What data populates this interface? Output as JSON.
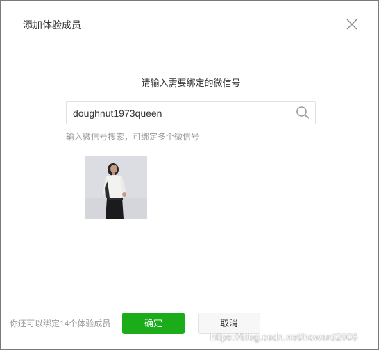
{
  "dialog": {
    "title": "添加体验成员",
    "close_icon": "close-icon"
  },
  "prompt": "请输入需要绑定的微信号",
  "search": {
    "value": "doughnut1973queen",
    "icon": "search-icon"
  },
  "hint": "输入微信号搜索，可绑定多个微信号",
  "result": {
    "avatar_icon": "user-avatar-photo"
  },
  "footer": {
    "note": "你还可以绑定14个体验成员",
    "confirm_label": "确定",
    "cancel_label": "取消"
  },
  "watermark": "https://blog.csdn.net/howard2005",
  "colors": {
    "primary": "#1aad19",
    "text": "#353535",
    "muted": "#9a9a9a",
    "border": "#e0e0e0"
  }
}
